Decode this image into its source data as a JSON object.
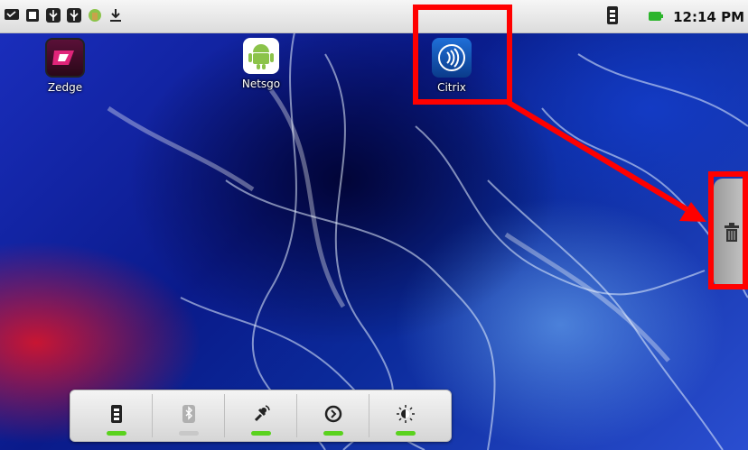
{
  "status_bar": {
    "time": "12:14 PM",
    "notification_icons": [
      "message-icon",
      "sd-card-icon",
      "usb-icon",
      "usb-debug-icon",
      "android-update-icon",
      "download-icon"
    ],
    "signal_icon": "signal-icon",
    "battery_icon": "battery-icon",
    "battery_color": "#2db52d"
  },
  "desktop": {
    "apps": [
      {
        "label": "Zedge",
        "icon": "zedge-icon"
      },
      {
        "label": "Netsgo",
        "icon": "android-icon"
      },
      {
        "label": "Citrix",
        "icon": "citrix-receiver-icon"
      }
    ],
    "trash_icon": "trash-icon"
  },
  "annotation": {
    "color": "#ff0000"
  },
  "power_widget": {
    "toggles": [
      {
        "name": "wifi",
        "icon": "wifi-icon",
        "state": "on"
      },
      {
        "name": "bluetooth",
        "icon": "bluetooth-icon",
        "state": "off"
      },
      {
        "name": "gps",
        "icon": "gps-icon",
        "state": "on"
      },
      {
        "name": "sync",
        "icon": "sync-icon",
        "state": "on"
      },
      {
        "name": "brightness",
        "icon": "brightness-icon",
        "state": "on"
      }
    ],
    "on_color": "#5ad21e",
    "off_color": "#c8c8c8"
  }
}
